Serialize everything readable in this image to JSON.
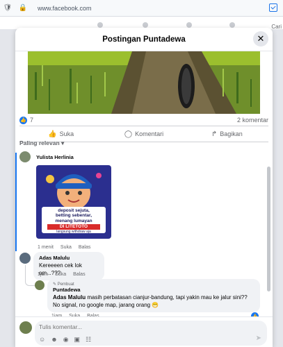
{
  "browser": {
    "url": "www.facebook.com"
  },
  "background": {
    "search_label": "Cari"
  },
  "modal": {
    "title": "Postingan Puntadewa",
    "close_icon": "close-icon"
  },
  "post": {
    "reaction_count": "7",
    "comment_count": "2 komentar",
    "actions": {
      "like": "Suka",
      "comment": "Komentari",
      "share": "Bagikan"
    }
  },
  "sort": {
    "label": "Paling relevan"
  },
  "comments": [
    {
      "author": "Yulista Herlinia",
      "ad_text": {
        "line1": "deposit sejuta,",
        "line2": "betting sebentar,",
        "line3": "menang lumayan",
        "brand": "DI LITETOTO",
        "tagline": "langsung withdraw aja"
      },
      "meta": {
        "time": "1 menit",
        "like": "Suka",
        "reply": "Balas"
      }
    },
    {
      "author": "Adas Malulu",
      "text": "Kereeeen cek lok om...???",
      "meta": {
        "time": "1jam",
        "like": "Suka",
        "reply": "Balas"
      }
    },
    {
      "author_tag": "Pembuat",
      "author": "Puntadewa",
      "mention": "Adas Malulu",
      "text": " masih perbatasan cianjur-bandung, tapi yakin mau ke jalur sini?? No signal, no google map, jarang orang 😁",
      "meta": {
        "time": "1jam",
        "like": "Suka",
        "reply": "Balas"
      }
    }
  ],
  "composer": {
    "placeholder": "Tulis komentar..."
  },
  "colors": {
    "accent": "#1877f2",
    "bubble": "#f0f2f5"
  }
}
